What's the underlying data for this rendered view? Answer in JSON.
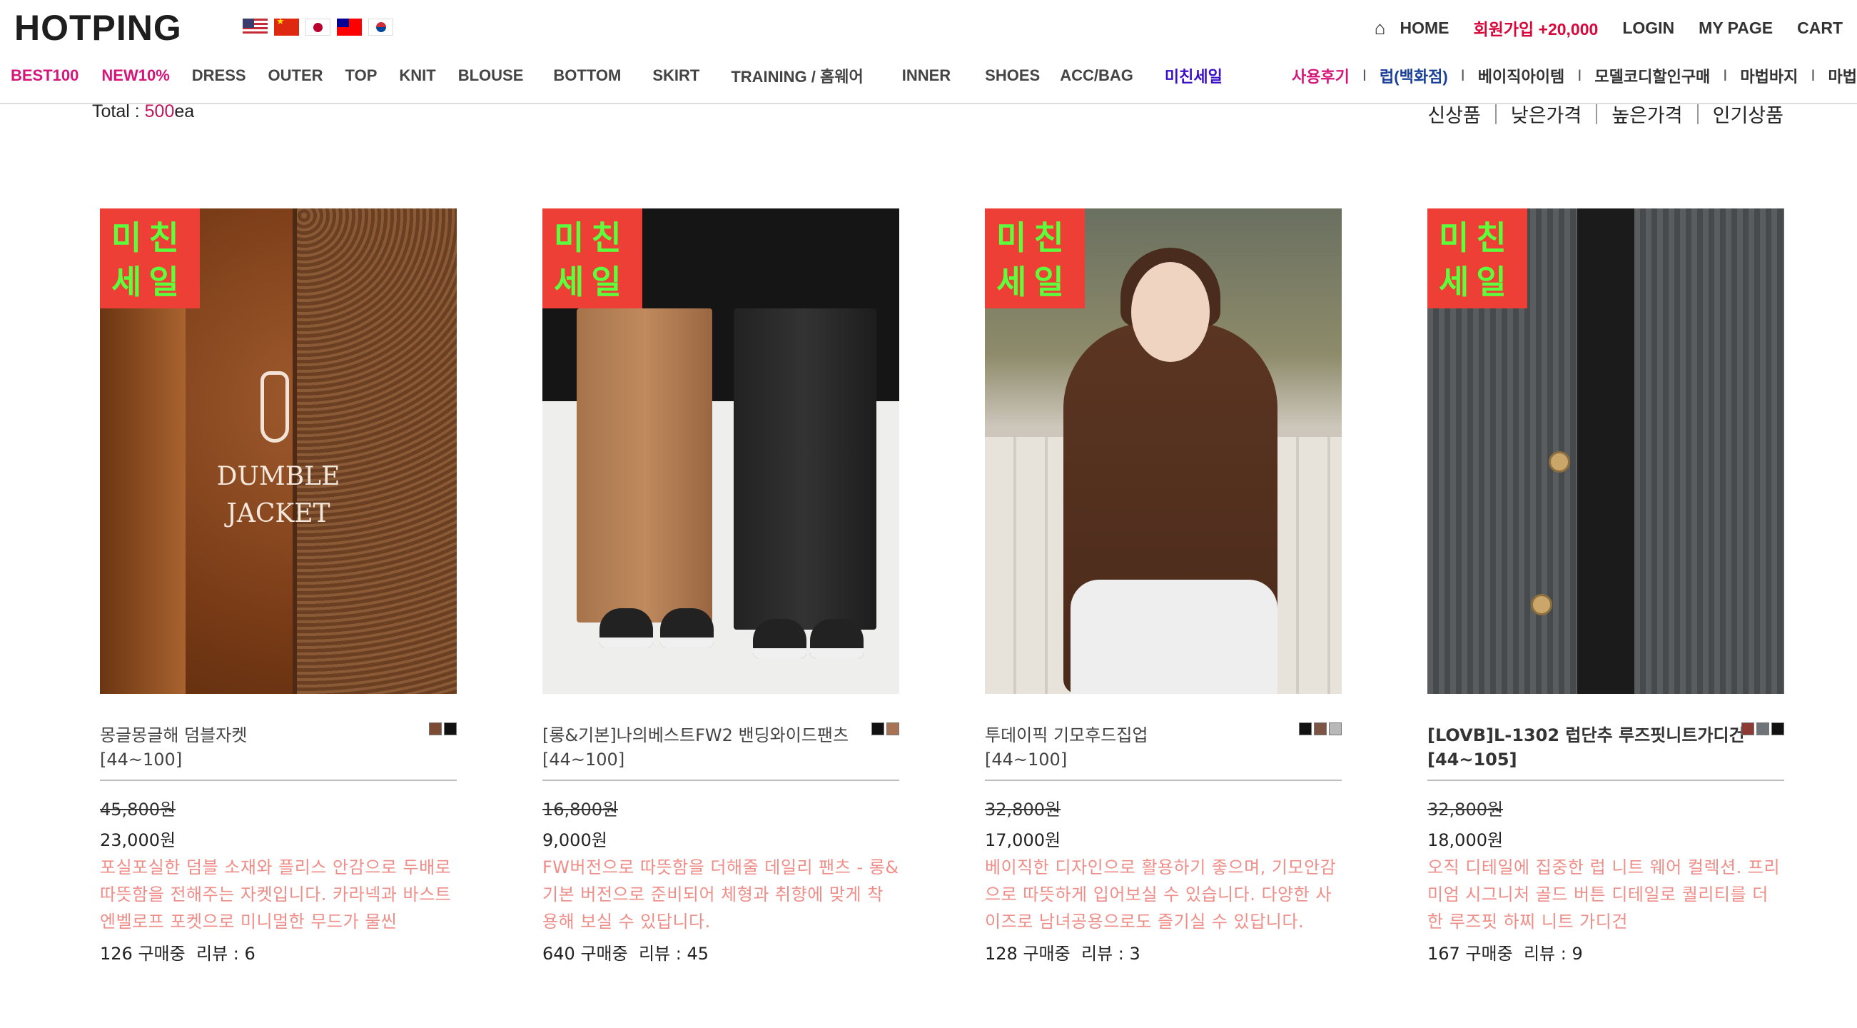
{
  "brand": {
    "logo_text": "HOTPING"
  },
  "flags": [
    {
      "icon": "us-flag-icon"
    },
    {
      "icon": "china-flag-icon"
    },
    {
      "icon": "japan-flag-icon"
    },
    {
      "icon": "taiwan-flag-icon"
    },
    {
      "icon": "korea-flag-icon"
    }
  ],
  "topnav": {
    "home_icon": "home-icon",
    "home": "HOME",
    "join": "회원가입 +20,000",
    "login": "LOGIN",
    "mypage": "MY PAGE",
    "cart": "CART"
  },
  "categories": [
    "BEST100",
    "NEW10%",
    "DRESS",
    "OUTER",
    "TOP",
    "KNIT",
    "BLOUSE",
    "BOTTOM",
    "SKIRT",
    "TRAINING / 홈웨어",
    "INNER",
    "SHOES",
    "ACC/BAG",
    "미친세일"
  ],
  "subnav": [
    "사용후기",
    "럽(백화점)",
    "베이직아이템",
    "모델코디할인구매",
    "마법바지",
    "마법"
  ],
  "total": {
    "label": "Total : ",
    "count": "500",
    "unit": "ea"
  },
  "sort_options": [
    "신상품",
    "낮은가격",
    "높은가격",
    "인기상품"
  ],
  "badge_text": "미친세일",
  "image_texts": {
    "dumble_line1": "DUMBLE",
    "dumble_line2": "JACKET"
  },
  "products": [
    {
      "name": "몽글몽글해 덤블자켓",
      "size": "[44~100]",
      "swatches": [
        "#7b4b33",
        "#111111"
      ],
      "old_price": "45,800원",
      "price": "23,000원",
      "desc": "포실포실한 덤블 소재와 플리스 안감으로 두배로 따뜻함을 전해주는 자켓입니다. 카라넥과 바스트 엔벨로프 포켓으로 미니멀한 무드가 물씬",
      "buyers": "126 구매중",
      "reviews": "리뷰 : 6"
    },
    {
      "name": "[롱&기본]나의베스트FW2 밴딩와이드팬츠",
      "size": "[44~100]",
      "swatches": [
        "#111111",
        "#a87355"
      ],
      "old_price": "16,800원",
      "price": "9,000원",
      "desc": "FW버전으로 따뜻함을 더해줄 데일리 팬츠 - 롱&기본 버전으로 준비되어 체형과 취향에 맞게 착용해 보실 수 있답니다.",
      "buyers": "640 구매중",
      "reviews": "리뷰 : 45"
    },
    {
      "name": "투데이픽 기모후드집업",
      "size": "[44~100]",
      "swatches": [
        "#111111",
        "#7d5544",
        "#b8b8b8"
      ],
      "old_price": "32,800원",
      "price": "17,000원",
      "desc": "베이직한 디자인으로 활용하기 좋으며, 기모안감으로 따뜻하게 입어보실 수 있습니다. 다양한 사이즈로 남녀공용으로도 즐기실 수 있답니다.",
      "buyers": "128 구매중",
      "reviews": "리뷰 : 3"
    },
    {
      "name": "[LOVB]L-1302 럽단추 루즈핏니트가디건",
      "size": "[44~105]",
      "swatches": [
        "#8d3a34",
        "#6f7478",
        "#111111"
      ],
      "old_price": "32,800원",
      "price": "18,000원",
      "desc": "오직 디테일에 집중한 럽 니트 웨어 컬렉션. 프리미엄 시그니처 골드 버튼 디테일로 퀄리티를 더한 루즈핏 하찌 니트 가디건",
      "buyers": "167 구매중",
      "reviews": "리뷰 : 9"
    }
  ]
}
